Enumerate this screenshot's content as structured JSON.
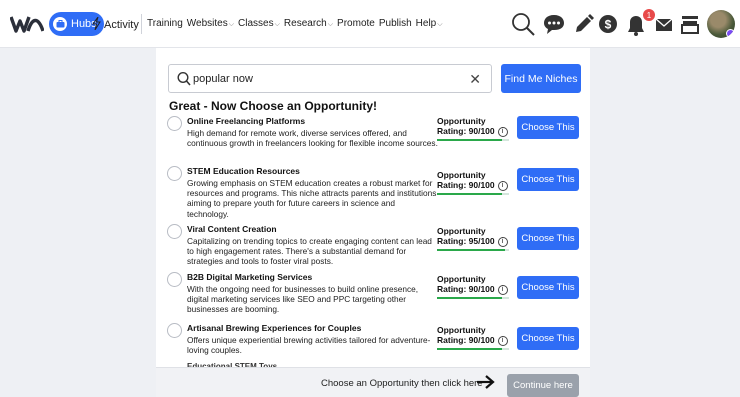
{
  "nav": {
    "hubs_label": "Hubs",
    "activity_label": "Activity",
    "menu": [
      {
        "label": "Training",
        "dropdown": false
      },
      {
        "label": "Websites",
        "dropdown": true
      },
      {
        "label": "Classes",
        "dropdown": true
      },
      {
        "label": "Research",
        "dropdown": true
      },
      {
        "label": "Promote",
        "dropdown": false
      },
      {
        "label": "Publish",
        "dropdown": false
      },
      {
        "label": "Help",
        "dropdown": true
      }
    ],
    "notification_count": "1",
    "colors": {
      "accent": "#2f6df6",
      "badge": "#e84a4a"
    }
  },
  "search": {
    "value": "popular now",
    "placeholder": "",
    "button_label": "Find Me Niches"
  },
  "heading": "Great - Now Choose an Opportunity!",
  "opportunities": [
    {
      "title": "Online Freelancing Platforms",
      "desc": "High demand for remote work, diverse services offered, and continuous growth in freelancers looking for flexible income sources.",
      "label": "Opportunity",
      "rating": "Rating: 90/100",
      "score": 90,
      "button": "Choose This"
    },
    {
      "title": "STEM Education Resources",
      "desc": "Growing emphasis on STEM education creates a robust market for resources and programs. This niche attracts parents and institutions aiming to prepare youth for future careers in science and technology.",
      "label": "Opportunity",
      "rating": "Rating: 90/100",
      "score": 90,
      "button": "Choose This"
    },
    {
      "title": "Viral Content Creation",
      "desc": "Capitalizing on trending topics to create engaging content can lead to high engagement rates. There's a substantial demand for strategies and tools to foster viral posts.",
      "label": "Opportunity",
      "rating": "Rating: 95/100",
      "score": 95,
      "button": "Choose This"
    },
    {
      "title": "B2B Digital Marketing Services",
      "desc": "With the ongoing need for businesses to build online presence, digital marketing services like SEO and PPC targeting other businesses are booming.",
      "label": "Opportunity",
      "rating": "Rating: 90/100",
      "score": 90,
      "button": "Choose This"
    },
    {
      "title": "Artisanal Brewing Experiences for Couples",
      "desc": "Offers unique experiential brewing activities tailored for adventure-loving couples.",
      "label": "Opportunity",
      "rating": "Rating: 90/100",
      "score": 90,
      "button": "Choose This"
    }
  ],
  "partial_item_title": "Educational STEM Toys",
  "footer": {
    "message": "Choose an Opportunity then click here",
    "continue_label": "Continue here"
  }
}
